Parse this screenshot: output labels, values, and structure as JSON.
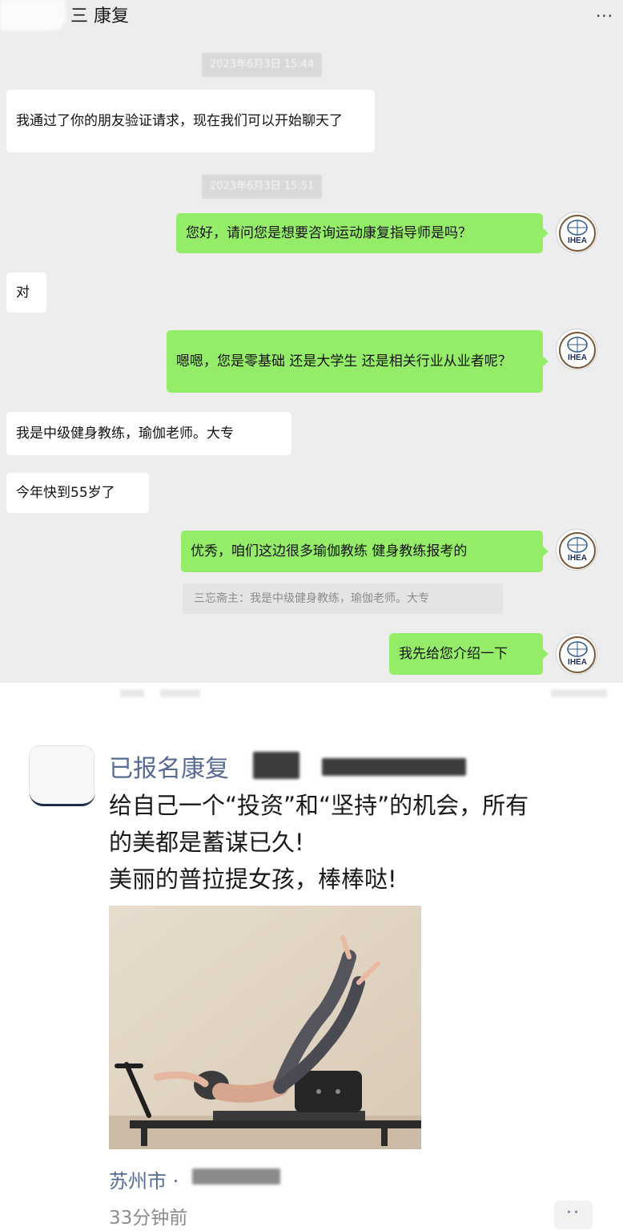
{
  "chat": {
    "title": "三 康复",
    "more_label": "···",
    "timestamps": [
      "2023年6月3日 15:44",
      "2023年6月3日 15:51"
    ],
    "messages": [
      {
        "side": "in",
        "text": "我通过了你的朋友验证请求，现在我们可以开始聊天了"
      },
      {
        "side": "out",
        "text": "您好，请问您是想要咨询运动康复指导师是吗？"
      },
      {
        "side": "in",
        "text": "对"
      },
      {
        "side": "out",
        "text": "嗯嗯，您是零基础 还是大学生 还是相关行业从业者呢？"
      },
      {
        "side": "in",
        "text": "我是中级健身教练，瑜伽老师。大专"
      },
      {
        "side": "in",
        "text": "今年快到55岁了"
      },
      {
        "side": "out",
        "text": "优秀，咱们这边很多瑜伽教练  健身教练报考的"
      },
      {
        "side": "out",
        "text": "我先给您介绍一下"
      }
    ],
    "quote": "三忘斋主：我是中级健身教练，瑜伽老师。大专",
    "avatar_text": "IHEA"
  },
  "post": {
    "name": "已报名康复",
    "lines": [
      "给自己一个“投资”和“坚持”的机会，所有",
      "的美都是蓄谋已久!",
      "美丽的普拉提女孩，棒棒哒!"
    ],
    "location": "苏州市 ·",
    "time": "33分钟前",
    "more_label": "··"
  },
  "colors": {
    "chat_bg": "#ededed",
    "bubble_out": "#95ec69",
    "bubble_in": "#ffffff",
    "link_blue": "#576b95"
  },
  "icons": [
    "more-icon",
    "ihea-logo-icon",
    "blurred-avatar",
    "pilates-photo"
  ]
}
